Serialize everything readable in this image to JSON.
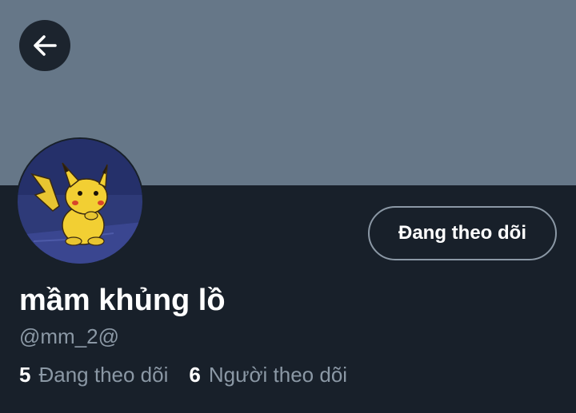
{
  "profile": {
    "display_name": "mầm khủng lồ",
    "handle": "@mm_2@",
    "follow_button_label": "Đang theo dõi",
    "stats": {
      "following_count": "5",
      "following_label": "Đang theo dõi",
      "followers_count": "6",
      "followers_label": "Người theo dõi"
    }
  },
  "icons": {
    "back": "arrow-left-icon",
    "avatar": "pikachu-avatar"
  },
  "colors": {
    "banner": "#667788",
    "background": "#18202a",
    "text_primary": "#ffffff",
    "text_secondary": "#8b98a5",
    "button_border": "#8b98a5"
  }
}
